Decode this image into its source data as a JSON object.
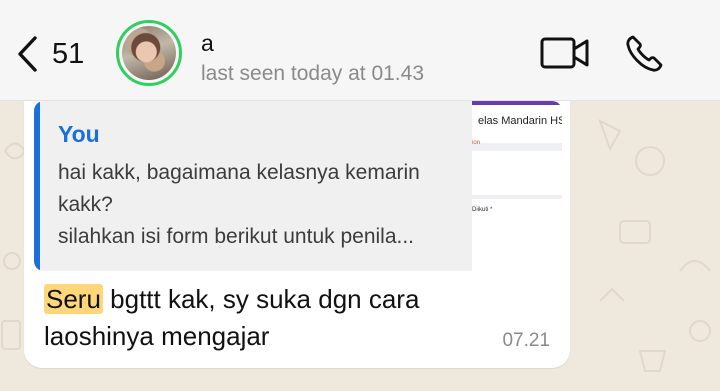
{
  "header": {
    "back_count": "51",
    "contact_name": "a",
    "contact_status": "last seen today at 01.43"
  },
  "icons": {
    "back": "chevron-left-icon",
    "video": "video-camera-icon",
    "call": "phone-icon"
  },
  "message": {
    "reply": {
      "author": "You",
      "lines": [
        "hai kakk, bagaimana kelasnya kemarin",
        "kakk?",
        "silahkan isi form berikut untuk penila..."
      ],
      "thumbnail_title": "elas Mandarin HSK",
      "thumbnail_red": "ion",
      "thumbnail_small": "Diikuti *"
    },
    "highlight": "Seru",
    "line1_rest": " bgttt kak, sy suka dgn cara",
    "line2": "laoshinya mengajar",
    "time": "07.21"
  },
  "colors": {
    "header_bg": "#f6f6f6",
    "chat_bg": "#efe9dd",
    "bubble_bg": "#ffffff",
    "quote_bg": "#f0f0f0",
    "accent_blue": "#1a6fd8",
    "avatar_ring": "#2fcf60",
    "highlight": "#ffd77a"
  }
}
